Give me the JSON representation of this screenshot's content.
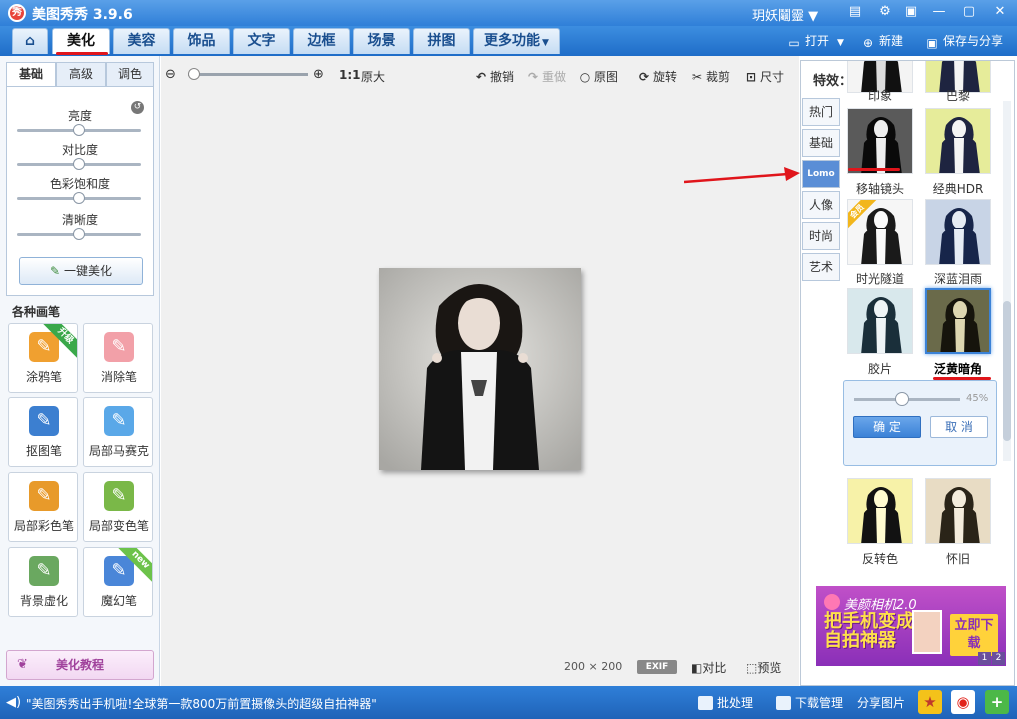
{
  "titlebar": {
    "logo": "秀",
    "title": "美图秀秀 3.9.6",
    "user": "玥妖鬮靈 ▼"
  },
  "nav": {
    "tabs": [
      "美化",
      "美容",
      "饰品",
      "文字",
      "边框",
      "场景",
      "拼图"
    ],
    "more": "更多功能",
    "actions": {
      "open": "打开",
      "new": "新建",
      "save": "保存与分享"
    }
  },
  "left": {
    "tabs": [
      "基础",
      "高级",
      "调色"
    ],
    "sliders": [
      {
        "label": "亮度",
        "value": 0.5
      },
      {
        "label": "对比度",
        "value": 0.5
      },
      {
        "label": "色彩饱和度",
        "value": 0.5
      },
      {
        "label": "清晰度",
        "value": 0.5
      }
    ],
    "onekey": "一键美化",
    "brushes_title": "各种画笔",
    "brushes": [
      {
        "label": "涂鸦笔",
        "badge": "升级",
        "icon": "brush-icon",
        "color": "#f0a030"
      },
      {
        "label": "消除笔",
        "badge": "",
        "icon": "eraser-icon",
        "color": "#f2a0a8"
      },
      {
        "label": "抠图笔",
        "badge": "",
        "icon": "cutout-pen-icon",
        "color": "#3c7fd0"
      },
      {
        "label": "局部马赛克",
        "badge": "",
        "icon": "mosaic-icon",
        "color": "#5aa8e8"
      },
      {
        "label": "局部彩色笔",
        "badge": "",
        "icon": "color-brush-icon",
        "color": "#e89a2a"
      },
      {
        "label": "局部变色笔",
        "badge": "",
        "icon": "paint-bucket-icon",
        "color": "#7ab848"
      },
      {
        "label": "背景虚化",
        "badge": "",
        "icon": "background-blur-icon",
        "color": "#6aa860"
      },
      {
        "label": "魔幻笔",
        "badge": "new",
        "icon": "magic-wand-icon",
        "color": "#4a86d8"
      }
    ],
    "tutorial": "美化教程"
  },
  "canvas": {
    "ratio": "1:1",
    "orig": "原大",
    "zoom": 0.05,
    "tools": {
      "undo": "撤销",
      "redo": "重做",
      "original": "原图",
      "rotate": "旋转",
      "crop": "裁剪",
      "size": "尺寸"
    },
    "image_size": "200 × 200",
    "exif": "EXIF",
    "compare": "对比",
    "preview": "预览"
  },
  "effects": {
    "title": "特效：",
    "categories": [
      "热门",
      "基础",
      "Lomo",
      "人像",
      "时尚",
      "艺术"
    ],
    "active_category": "Lomo",
    "items": [
      {
        "label": "印象",
        "tone": "bw-bright"
      },
      {
        "label": "巴黎",
        "tone": "yellow"
      },
      {
        "label": "移轴镜头",
        "tone": "vignette"
      },
      {
        "label": "经典HDR",
        "tone": "yellow"
      },
      {
        "label": "时光隧道",
        "tone": "bright"
      },
      {
        "label": "深蓝泪雨",
        "tone": "blue"
      },
      {
        "label": "胶片",
        "tone": "teal"
      },
      {
        "label": "泛黄暗角",
        "tone": "sepia-dark"
      },
      {
        "label": "反转色",
        "tone": "inverse-yellow"
      },
      {
        "label": "怀旧",
        "tone": "sepia"
      }
    ],
    "vip_badge": "会员",
    "strength": 0.45,
    "strength_label": "45%",
    "ok": "确 定",
    "cancel": "取 消"
  },
  "ad": {
    "title": "美颜相机2.0",
    "slogan": "把手机变成自拍神器",
    "cta": "立即下载",
    "pages": [
      "1",
      "2"
    ]
  },
  "status": {
    "message": "\"美图秀秀出手机啦!全球第一款800万前置摄像头的超级自拍神器\"",
    "batch": "批处理",
    "download": "下载管理",
    "share": "分享图片"
  }
}
